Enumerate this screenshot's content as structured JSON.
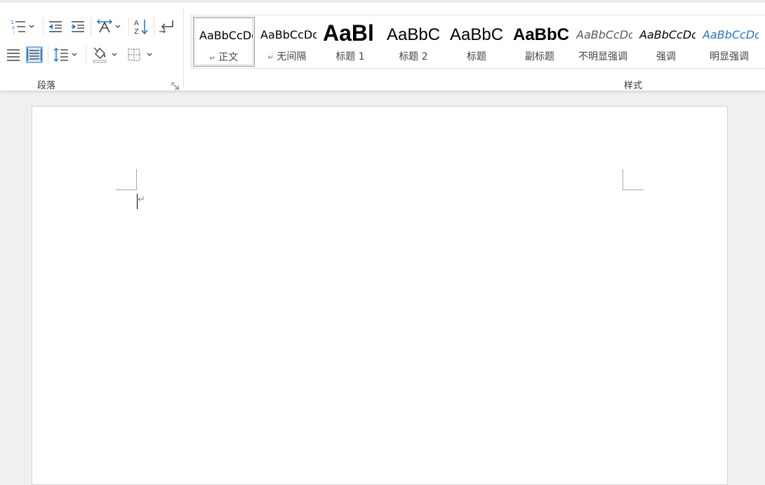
{
  "ribbon": {
    "paragraph_group": {
      "label": "段落",
      "buttons": [
        {
          "name": "multilevel-list",
          "icon": "multilevel-list-icon"
        },
        {
          "name": "decrease-indent",
          "icon": "decrease-indent-icon"
        },
        {
          "name": "increase-indent",
          "icon": "increase-indent-icon"
        },
        {
          "name": "chinese-layout",
          "icon": "chinese-layout-icon"
        },
        {
          "name": "sort",
          "icon": "sort-az-icon"
        },
        {
          "name": "show-marks",
          "icon": "paragraph-mark-icon"
        },
        {
          "name": "justify",
          "icon": "justify-icon"
        },
        {
          "name": "distributed",
          "icon": "distributed-icon"
        },
        {
          "name": "line-spacing",
          "icon": "line-spacing-icon"
        },
        {
          "name": "shading",
          "icon": "shading-bucket-icon"
        },
        {
          "name": "borders",
          "icon": "borders-icon"
        }
      ]
    },
    "styles_group": {
      "label": "样式",
      "items": [
        {
          "sample": "AaBbCcDc",
          "name": "正文",
          "prefix": "↵",
          "selected": true
        },
        {
          "sample": "AaBbCcDc",
          "name": "无间隔",
          "prefix": "↵",
          "selected": false
        },
        {
          "sample": "AaBl",
          "name": "标题 1",
          "prefix": "",
          "selected": false
        },
        {
          "sample": "AaBbC",
          "name": "标题 2",
          "prefix": "",
          "selected": false
        },
        {
          "sample": "AaBbC",
          "name": "标题",
          "prefix": "",
          "selected": false
        },
        {
          "sample": "AaBbC",
          "name": "副标题",
          "prefix": "",
          "selected": false
        },
        {
          "sample": "AaBbCcDc",
          "name": "不明显强调",
          "prefix": "",
          "selected": false
        },
        {
          "sample": "AaBbCcDc",
          "name": "强调",
          "prefix": "",
          "selected": false
        },
        {
          "sample": "AaBbCcDc",
          "name": "明显强调",
          "prefix": "",
          "selected": false
        }
      ]
    }
  },
  "document": {
    "paragraph_mark": "↵"
  },
  "colors": {
    "accent_blue": "#2b88d8",
    "subtle_emphasis": "#595959",
    "intense_emphasis": "#2e74b5",
    "icon": "#444444",
    "highlight_blue": "#1a73c9"
  }
}
